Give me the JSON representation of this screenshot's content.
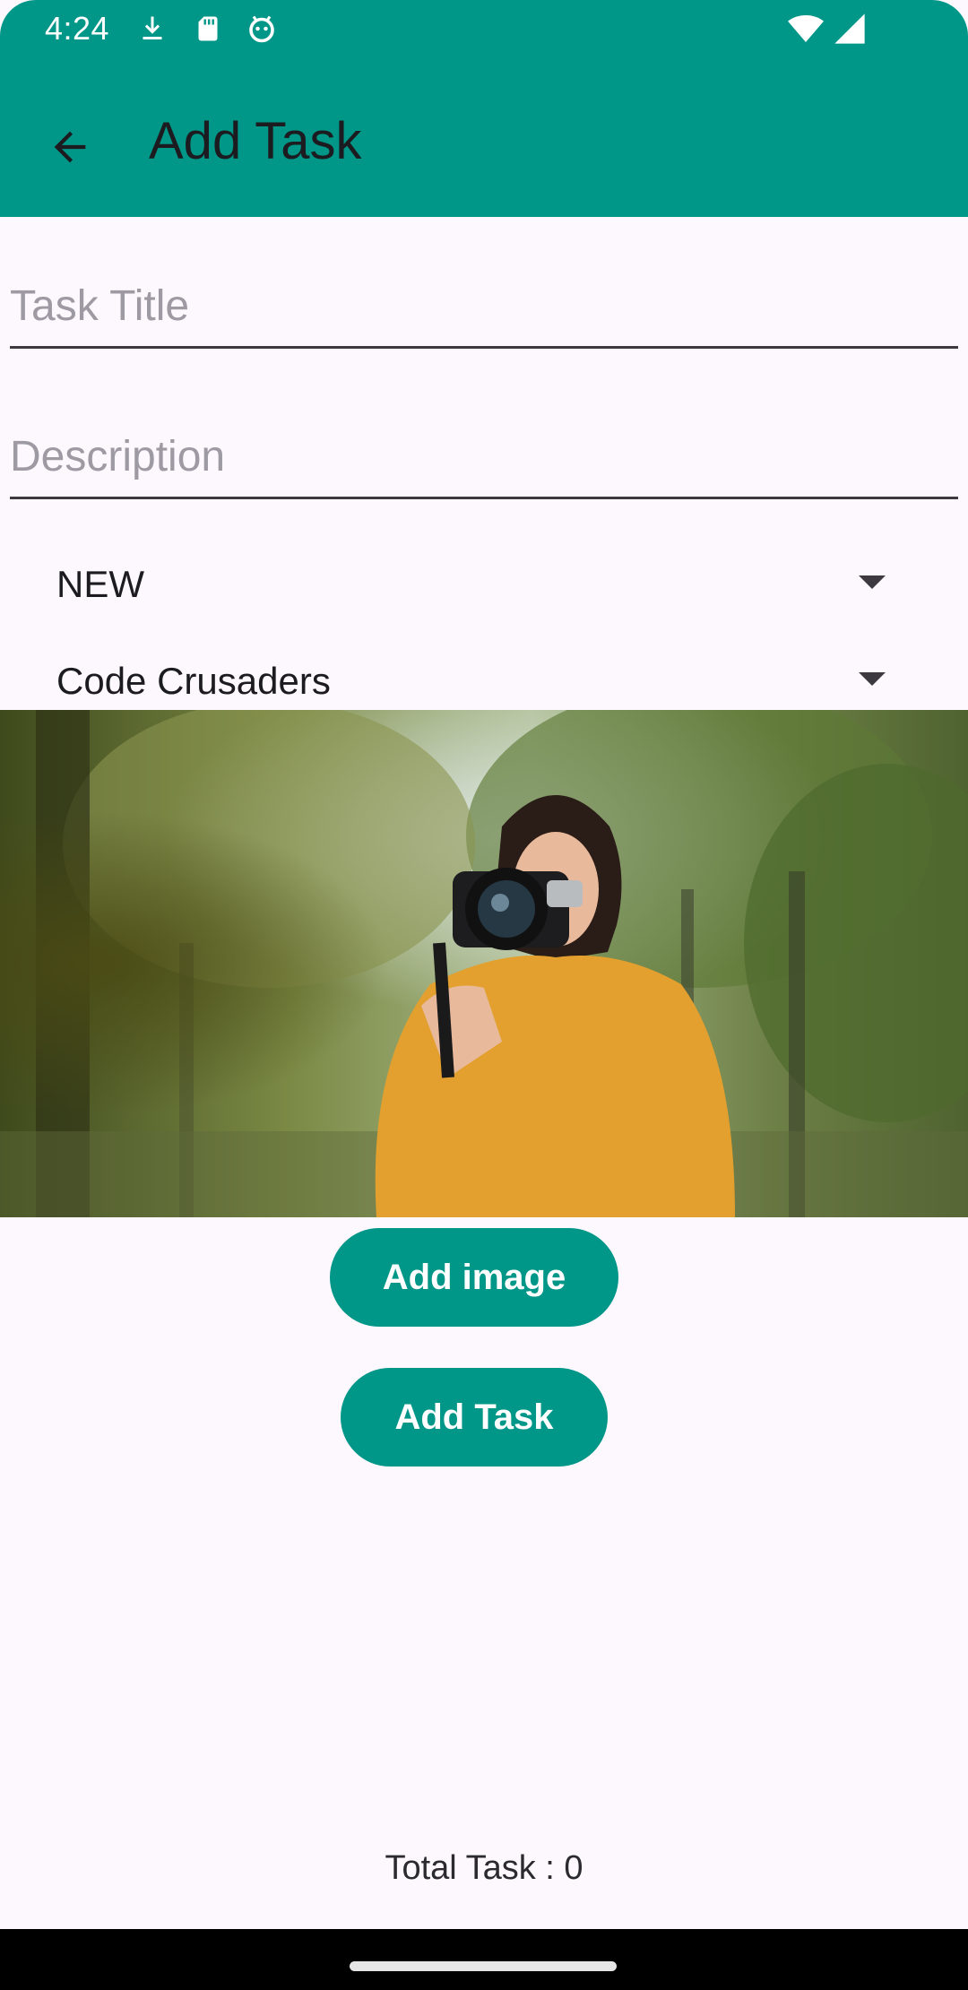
{
  "status_bar": {
    "time": "4:24",
    "left_icons": [
      "download-icon",
      "sd-card-icon",
      "android-debug-icon"
    ],
    "right_icons": [
      "wifi-icon",
      "cell-signal-icon"
    ]
  },
  "app_bar": {
    "title": "Add Task",
    "back_icon": "arrow-back-icon",
    "color": "#009688"
  },
  "form": {
    "task_title": {
      "value": "",
      "placeholder": "Task Title"
    },
    "description": {
      "value": "",
      "placeholder": "Description"
    },
    "status_spinner": {
      "selected": "NEW"
    },
    "team_spinner": {
      "selected": "Code Crusaders"
    }
  },
  "buttons": {
    "add_image": "Add image",
    "add_task": "Add Task"
  },
  "footer": {
    "total_task": "Total Task : 0"
  },
  "colors": {
    "primary": "#009688",
    "background": "#fdf8fd",
    "on_primary": "#ffffff"
  }
}
